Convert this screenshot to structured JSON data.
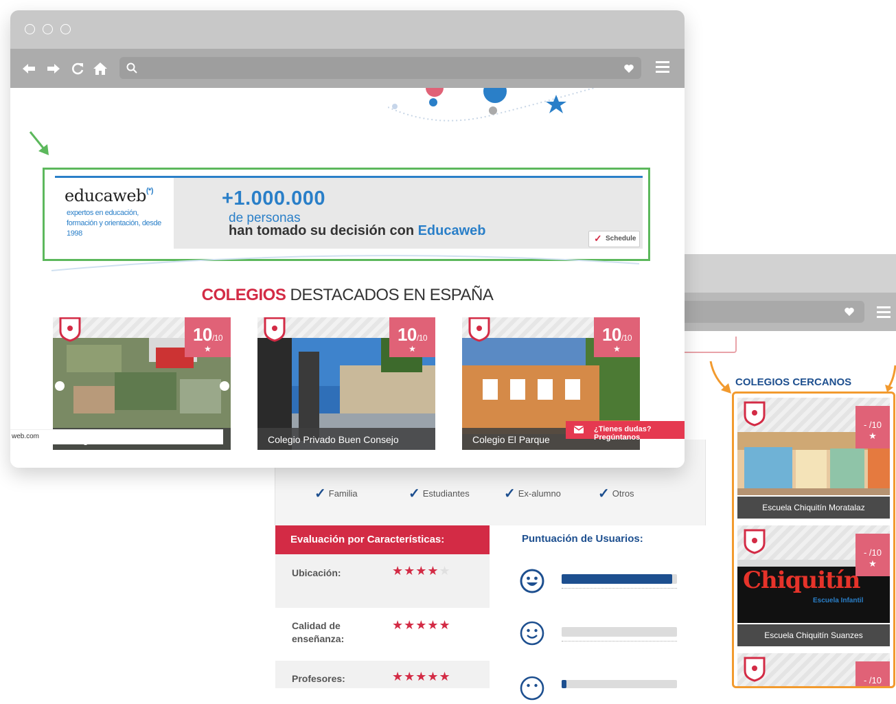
{
  "banner": {
    "brand": "educaweb",
    "brand_mark": "(*)",
    "tagline": "expertos en educación, formación y orientación, desde 1998",
    "big_number": "+1.000.000",
    "line1": "de personas",
    "line2_pre": "han tomado su decisión con ",
    "line2_brand": "Educaweb",
    "schedule_label": "Schedule"
  },
  "section": {
    "title_red": "COLEGIOS",
    "title_rest": " DESTACADOS EN ESPAÑA"
  },
  "schools": [
    {
      "score": "10",
      "scale": "/10",
      "caption": "Colegio Internacional de Levante"
    },
    {
      "score": "10",
      "scale": "/10",
      "caption": "Colegio Privado Buen Consejo"
    },
    {
      "score": "10",
      "scale": "/10",
      "caption": "Colegio El Parque"
    }
  ],
  "status_url": "web.com",
  "chat_label": "¿Tienes dudas? Pregúntanos",
  "opinion": {
    "checks": [
      "Familia",
      "Estudiantes",
      "Ex-alumno",
      "Otros"
    ]
  },
  "evaluation": {
    "header": "Evaluación por Características:",
    "rows": [
      {
        "label": "Ubicación:",
        "stars": 4
      },
      {
        "label": "Calidad de enseñanza:",
        "stars": 5
      },
      {
        "label": "Profesores:",
        "stars": 5
      }
    ]
  },
  "users": {
    "header": "Puntuación de Usuarios:",
    "bars": [
      {
        "face": "very-happy-face-icon",
        "fraction": 0.96
      },
      {
        "face": "happy-face-icon",
        "fraction": 0.0
      },
      {
        "face": "neutral-face-icon",
        "fraction": 0.04
      }
    ]
  },
  "nearby": {
    "title": "COLEGIOS CERCANOS",
    "items": [
      {
        "score": "- /10",
        "name": "Escuela Chiquitín Moratalaz"
      },
      {
        "score": "- /10",
        "name": "Escuela Chiquitín Suanzes"
      },
      {
        "score": "- /10",
        "name": ""
      }
    ],
    "logo_text": "Chiquitín",
    "logo_sub": "Escuela Infantil"
  },
  "colors": {
    "accent_red": "#d32b45",
    "score_pink": "#e06277",
    "brand_blue": "#2a7fc8",
    "navy": "#1d4f8f",
    "highlight_green": "#5cb85c",
    "highlight_orange": "#f29a2e"
  }
}
